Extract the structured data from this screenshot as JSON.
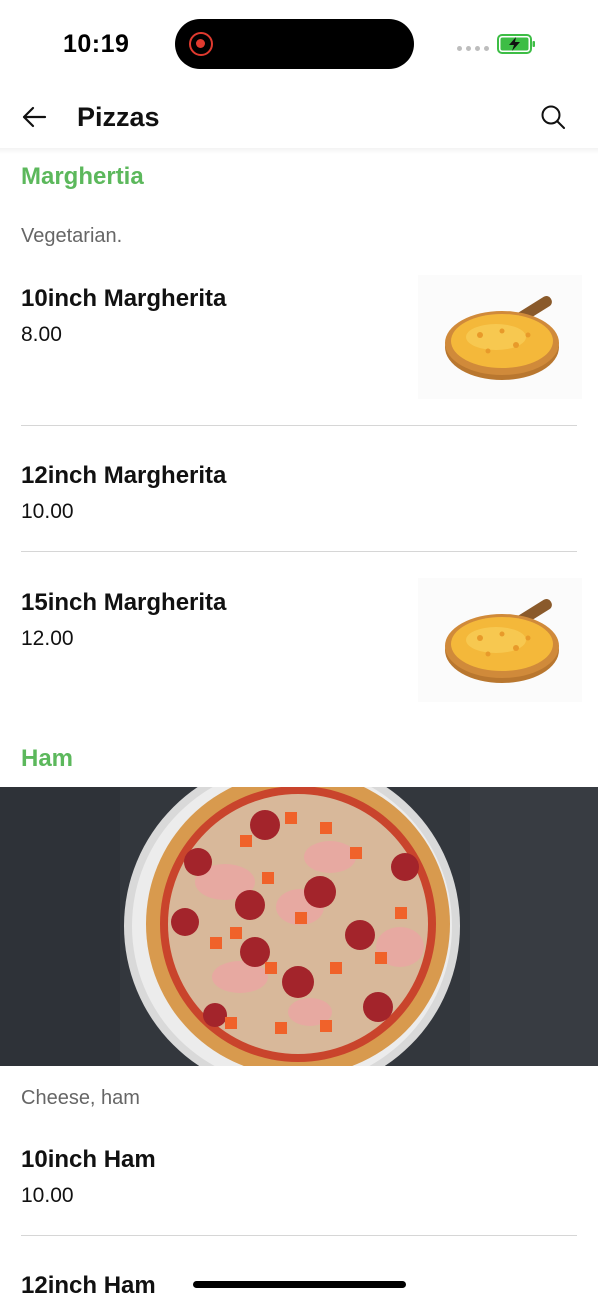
{
  "status": {
    "time": "10:19",
    "battery_color": "#3dbd45"
  },
  "header": {
    "title": "Pizzas",
    "back_icon": "arrow-left-icon",
    "search_icon": "search-icon"
  },
  "accent_color": "#5cb85c",
  "sections": [
    {
      "title": "Marghertia",
      "description": "Vegetarian.",
      "items": [
        {
          "name": "10inch Margherita",
          "price": "8.00",
          "has_image": true
        },
        {
          "name": "12inch Margherita",
          "price": "10.00",
          "has_image": false
        },
        {
          "name": "15inch Margherita",
          "price": "12.00",
          "has_image": true
        }
      ]
    },
    {
      "title": "Ham",
      "description": "Cheese, ham",
      "banner_image": "ham-pizza-photo",
      "items": [
        {
          "name": "10inch Ham",
          "price": "10.00",
          "has_image": false
        },
        {
          "name": "12inch Ham",
          "price": "",
          "has_image": false
        }
      ]
    }
  ]
}
